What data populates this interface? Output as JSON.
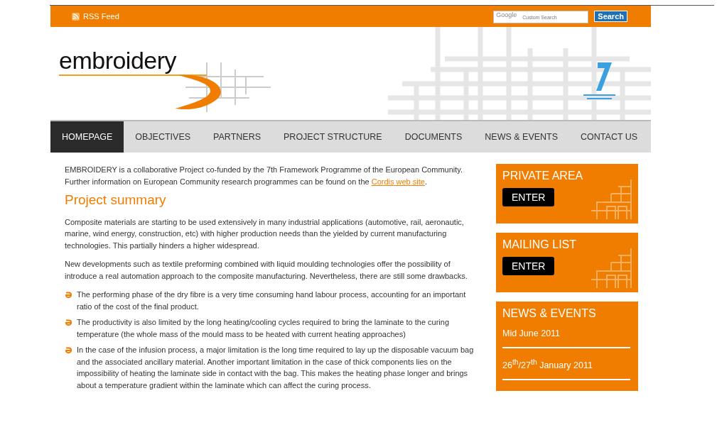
{
  "top_bar": {
    "rss_label": "RSS Feed",
    "search": {
      "logo": "Google",
      "placeholder": "Custom Search",
      "button": "Search"
    }
  },
  "header": {
    "logo": "embroidery"
  },
  "nav": [
    {
      "label": "HOMEPAGE",
      "selected": true
    },
    {
      "label": "OBJECTIVES",
      "selected": false
    },
    {
      "label": "PARTNERS",
      "selected": false
    },
    {
      "label": "PROJECT STRUCTURE",
      "selected": false
    },
    {
      "label": "DOCUMENTS",
      "selected": false
    },
    {
      "label": "NEWS & EVENTS",
      "selected": false
    },
    {
      "label": "CONTACT US",
      "selected": false
    }
  ],
  "main": {
    "intro": {
      "text": "EMBROIDERY is a collaborative Project co-funded by the 7th Framework Programme of the European Community. Further information on European Community research programmes can be found on the",
      "link": "Cordis web site",
      "after": "."
    },
    "heading": "Project summary",
    "paragraphs": [
      "Composite materials are starting to be used extensively in many industrial applications (automotive, rail, aeronautic, marine, wind energy, construction, etc) with higher production needs than the yielded by current manufacturing technologies. This partially hinders a higher widespread.",
      "New developments such as textile preforming combined with liquid moulding technologies offer the possibility of introduce a real automation approach to the composite manufacturing. Nevertheless, there are still some drawbacks."
    ],
    "bullets": [
      "The performing phase of the dry fibre is a very time consuming hand labour process, accounting for an important ratio of the cost of the final product.",
      "The productivity is also limited by the long heating/cooling cycles required to bring the laminate to the curing temperature (the whole mass of the mould mass to be heated with current heating approaches)",
      "In the case of the infusion process, a major limitation is the long time required to lay up the disposable vacuum bag and the associated ancillary material. Another important limitation in the case of thick components lies on the impossibility of heating the laminate side in contact with the bag. This makes the heating phase longer and brings about a temperature gradient within the laminate which can affect the curing process."
    ]
  },
  "sidebar": [
    {
      "kind": "action",
      "title": "PRIVATE AREA",
      "button": "ENTER"
    },
    {
      "kind": "action",
      "title": "MAILING LIST",
      "button": "ENTER"
    },
    {
      "kind": "news",
      "title": "NEWS & EVENTS",
      "items": [
        "Mid June 2011",
        "26$^{th}$/27$^{th}$ January 2011"
      ]
    }
  ]
}
